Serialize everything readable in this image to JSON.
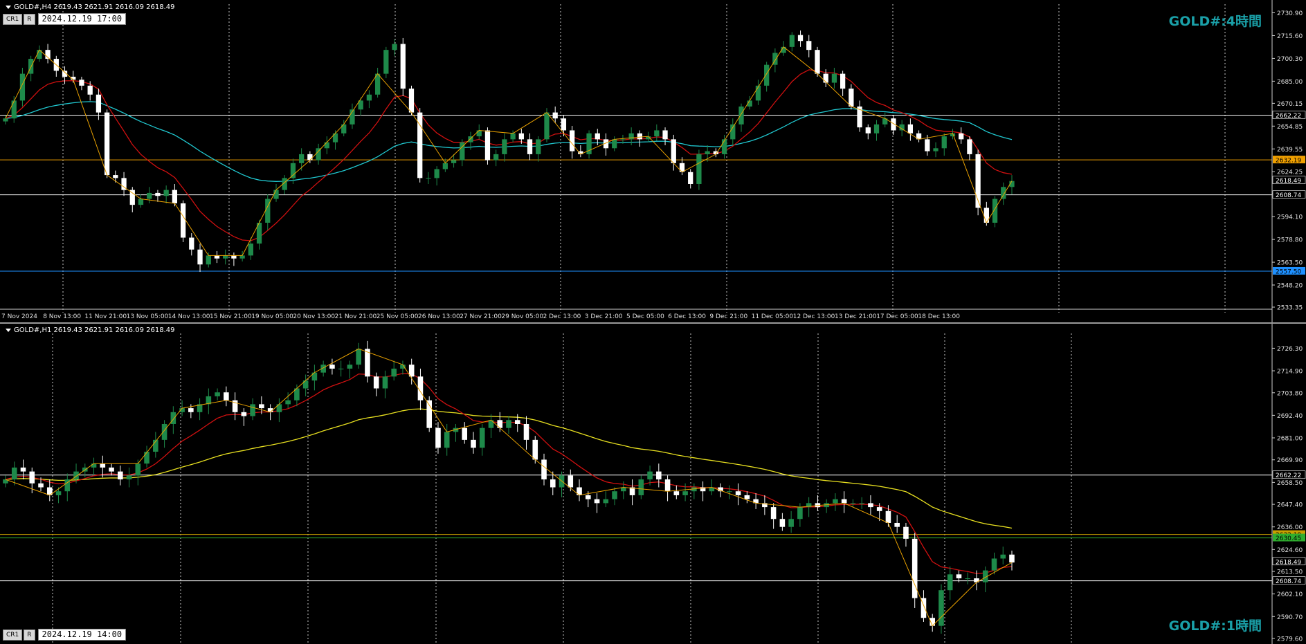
{
  "top_chart": {
    "symbol_header": "GOLD#,H4  2619.43 2621.91 2616.09 2618.49",
    "timeframe_label": "GOLD#:4時間",
    "buttons": {
      "cr1": "CR1",
      "r": "R"
    },
    "date_box": "2024.12.19 17:00",
    "price_scale": [
      "2730.90",
      "2715.60",
      "2700.30",
      "2685.00",
      "2670.15",
      "2654.85",
      "2639.55",
      "2624.25",
      "2609.40",
      "2594.10",
      "2578.80",
      "2563.50",
      "2548.20",
      "2533.35"
    ],
    "price_range": [
      2533.35,
      2733.0
    ],
    "horizontal_lines": [
      {
        "price": 2662.22,
        "label": "2662.22",
        "color": "#ffffff"
      },
      {
        "price": 2632.19,
        "label": "2632.19",
        "color": "#f0a000"
      },
      {
        "price": 2608.74,
        "label": "2608.74",
        "color": "#ffffff"
      },
      {
        "price": 2557.5,
        "label": "2557.50",
        "color": "#1e90ff"
      }
    ],
    "current_price": "2618.49",
    "time_axis": [
      "7 Nov 2024",
      "8 Nov 13:00",
      "11 Nov 21:00",
      "13 Nov 05:00",
      "14 Nov 13:00",
      "15 Nov 21:00",
      "19 Nov 05:00",
      "20 Nov 13:00",
      "21 Nov 21:00",
      "25 Nov 05:00",
      "26 Nov 13:00",
      "27 Nov 21:00",
      "29 Nov 05:00",
      "2 Dec 13:00",
      "3 Dec 21:00",
      "5 Dec 05:00",
      "6 Dec 13:00",
      "9 Dec 21:00",
      "11 Dec 05:00",
      "12 Dec 13:00",
      "13 Dec 21:00",
      "17 Dec 05:00",
      "18 Dec 13:00"
    ],
    "closes": [
      2660,
      2672,
      2690,
      2700,
      2706,
      2700,
      2692,
      2688,
      2686,
      2682,
      2676,
      2664,
      2622,
      2620,
      2612,
      2602,
      2606,
      2610,
      2608,
      2612,
      2603,
      2580,
      2572,
      2562,
      2568,
      2566,
      2568,
      2566,
      2568,
      2576,
      2590,
      2606,
      2612,
      2620,
      2630,
      2636,
      2632,
      2640,
      2644,
      2650,
      2656,
      2666,
      2672,
      2676,
      2690,
      2706,
      2710,
      2680,
      2664,
      2620,
      2620,
      2626,
      2630,
      2632,
      2644,
      2648,
      2652,
      2632,
      2636,
      2646,
      2650,
      2646,
      2636,
      2646,
      2664,
      2660,
      2652,
      2638,
      2636,
      2650,
      2646,
      2640,
      2646,
      2646,
      2650,
      2646,
      2648,
      2652,
      2646,
      2630,
      2624,
      2616,
      2636,
      2638,
      2636,
      2646,
      2656,
      2668,
      2672,
      2682,
      2696,
      2704,
      2708,
      2716,
      2712,
      2706,
      2690,
      2684,
      2690,
      2680,
      2668,
      2654,
      2650,
      2656,
      2660,
      2652,
      2656,
      2650,
      2646,
      2638,
      2640,
      2648,
      2650,
      2646,
      2636,
      2600,
      2590,
      2606,
      2614,
      2618
    ]
  },
  "bottom_chart": {
    "symbol_header": "GOLD#,H1  2619.43 2621.91 2616.09 2618.49",
    "timeframe_label": "GOLD#:1時間",
    "buttons": {
      "cr1": "CR1",
      "r": "R"
    },
    "date_box": "2024.12.19 14:00",
    "price_scale": [
      "2726.30",
      "2714.90",
      "2703.80",
      "2692.40",
      "2681.00",
      "2669.90",
      "2658.50",
      "2647.40",
      "2636.00",
      "2624.60",
      "2613.50",
      "2602.10",
      "2590.70",
      "2579.60"
    ],
    "price_range": [
      2579.6,
      2731.0
    ],
    "horizontal_lines": [
      {
        "price": 2662.22,
        "label": "2662.22",
        "color": "#ffffff"
      },
      {
        "price": 2632.19,
        "label": "2632.19",
        "color": "#c8a000"
      },
      {
        "price": 2630.45,
        "label": "2630.45",
        "color": "#2fae2f"
      },
      {
        "price": 2608.74,
        "label": "2608.74",
        "color": "#ffffff"
      }
    ],
    "current_price": "2618.49",
    "closes": [
      2660,
      2666,
      2664,
      2658,
      2656,
      2652,
      2654,
      2660,
      2664,
      2666,
      2668,
      2666,
      2664,
      2660,
      2662,
      2668,
      2674,
      2680,
      2688,
      2694,
      2696,
      2694,
      2698,
      2702,
      2704,
      2700,
      2694,
      2692,
      2698,
      2696,
      2694,
      2698,
      2700,
      2706,
      2710,
      2714,
      2718,
      2716,
      2716,
      2718,
      2726,
      2712,
      2706,
      2712,
      2716,
      2718,
      2712,
      2700,
      2686,
      2676,
      2684,
      2686,
      2680,
      2676,
      2686,
      2690,
      2686,
      2690,
      2688,
      2680,
      2670,
      2660,
      2656,
      2662,
      2656,
      2652,
      2650,
      2648,
      2650,
      2654,
      2656,
      2652,
      2660,
      2664,
      2660,
      2654,
      2652,
      2654,
      2656,
      2654,
      2656,
      2654,
      2654,
      2652,
      2650,
      2648,
      2646,
      2640,
      2636,
      2640,
      2646,
      2648,
      2646,
      2648,
      2650,
      2648,
      2648,
      2648,
      2646,
      2644,
      2638,
      2636,
      2630,
      2600,
      2590,
      2586,
      2604,
      2612,
      2610,
      2610,
      2608,
      2614,
      2620,
      2622,
      2618
    ]
  }
}
